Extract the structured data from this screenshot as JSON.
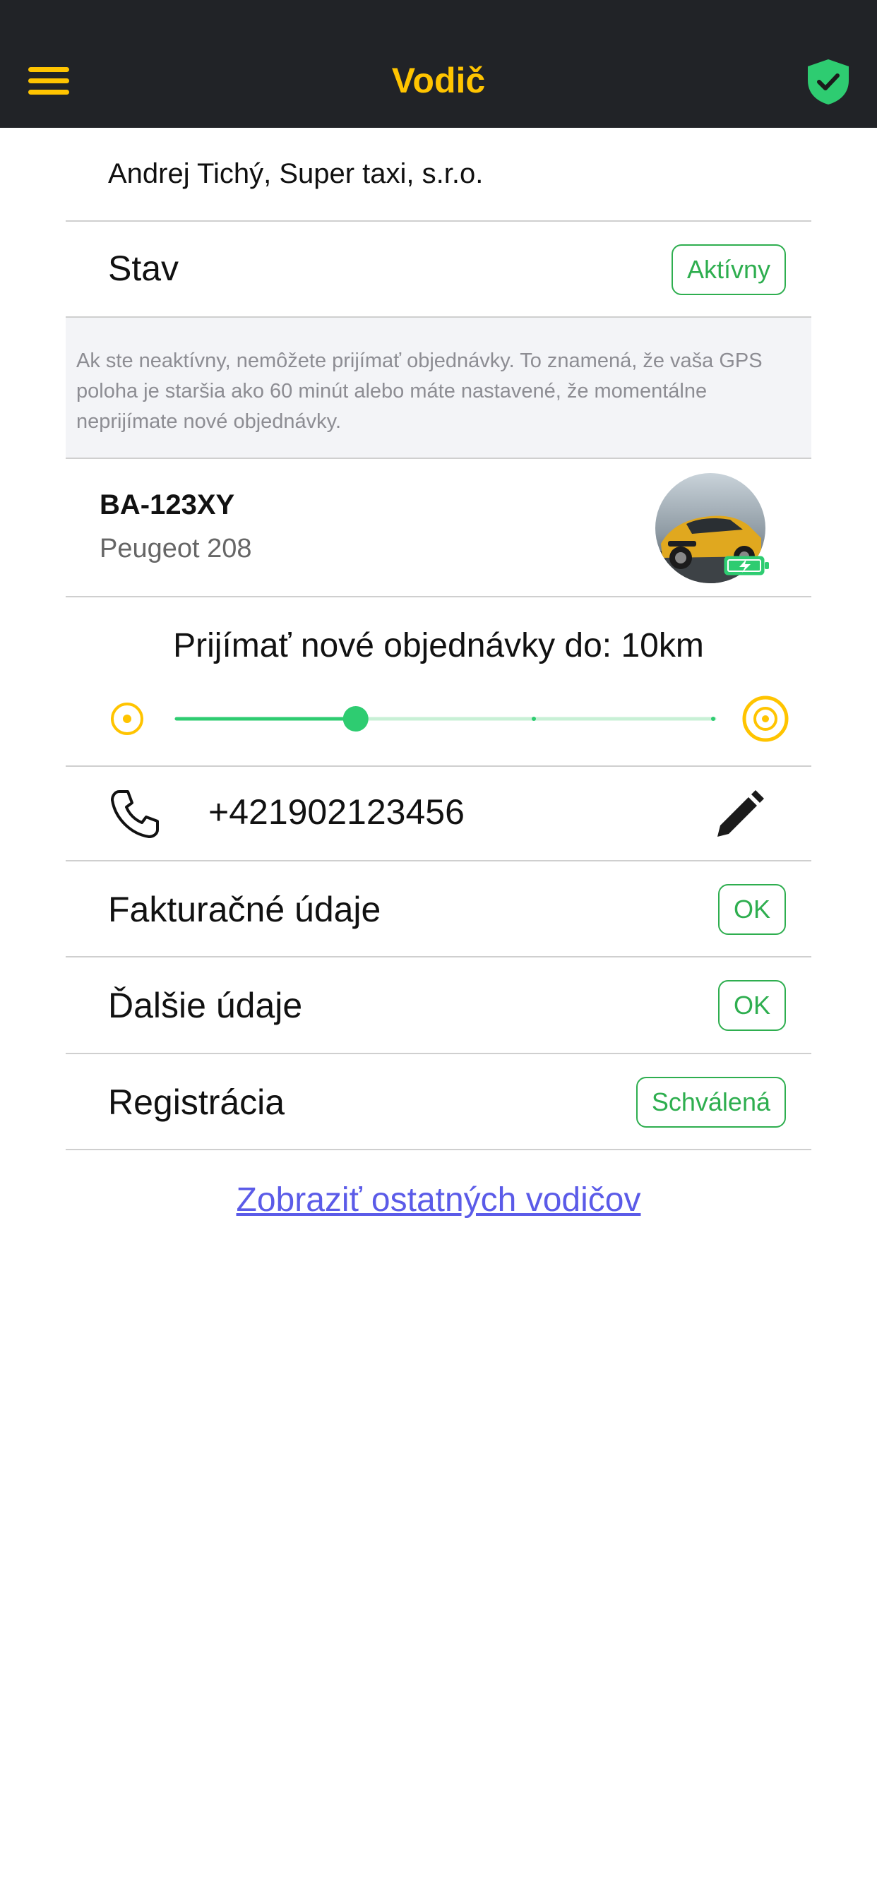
{
  "header": {
    "title": "Vodič"
  },
  "driver": {
    "name": "Andrej Tichý, Super taxi, s.r.o."
  },
  "status": {
    "label": "Stav",
    "value": "Aktívny"
  },
  "info": {
    "text": "Ak ste neaktívny, nemôžete prijímať objednávky. To znamená, že vaša GPS poloha je staršia ako 60 minút alebo máte nastavené, že momentálne neprijímate nové objednávky."
  },
  "vehicle": {
    "plate": "BA-123XY",
    "model": "Peugeot 208"
  },
  "orders": {
    "title": "Prijímať nové objednávky do: 10km",
    "slider_value_fraction": 0.333
  },
  "phone": {
    "number": "+421902123456"
  },
  "billing": {
    "label": "Fakturačné údaje",
    "value": "OK"
  },
  "other": {
    "label": "Ďalšie údaje",
    "value": "OK"
  },
  "registration": {
    "label": "Registrácia",
    "value": "Schválená"
  },
  "footer": {
    "link": "Zobraziť ostatných vodičov"
  },
  "colors": {
    "header_bg": "#212327",
    "accent_yellow": "#FFC400",
    "success_green": "#2EAE4F",
    "link_blue": "#5B5BE8"
  }
}
